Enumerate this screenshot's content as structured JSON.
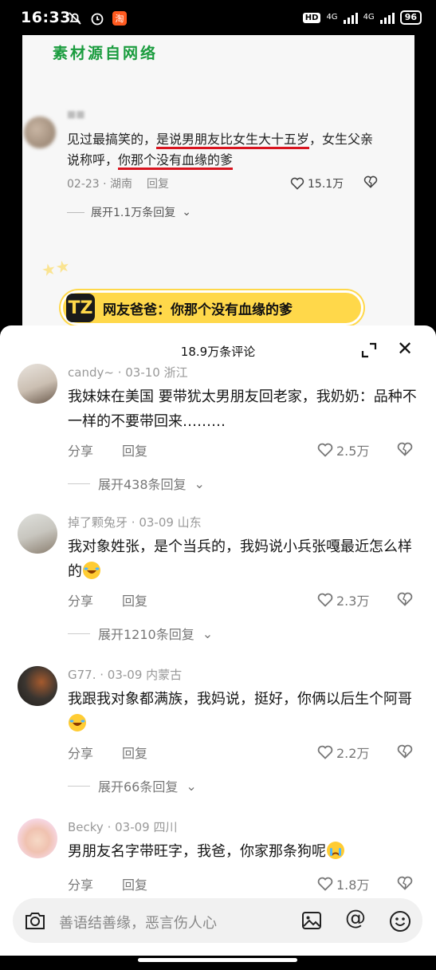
{
  "status_bar": {
    "time": "16:33",
    "hd": "HD",
    "net1": "4G",
    "net2": "4G",
    "battery": "96"
  },
  "video": {
    "watermark": "素材源自网络",
    "bg_comment": {
      "text_before": "见过最搞笑的，",
      "text_ul1": "是说男朋友比女生大十五岁",
      "text_mid": "，女生父亲说称呼，",
      "text_ul2": "你那个没有血缘的爹",
      "date_loc": "02-23 · 湖南",
      "reply": "回复",
      "likes": "15.1万",
      "expand": "展开1.1万条回复"
    },
    "banner": {
      "logo": "TZ",
      "text": "网友爸爸：你那个没有血缘的爹"
    }
  },
  "sheet": {
    "title": "18.9万条评论",
    "comments": [
      {
        "user": "candy~",
        "meta": " · 03-10 浙江",
        "text": "我妹妹在美国 要带犹太男朋友回老家，我奶奶：品种不一样的不要带回来………",
        "share": "分享",
        "reply": "回复",
        "likes": "2.5万",
        "expand": "展开438条回复"
      },
      {
        "user": "掉了颗兔牙",
        "meta": " · 03-09 山东",
        "text": "我对象姓张，是个当兵的，我妈说小兵张嘎最近怎么样的",
        "share": "分享",
        "reply": "回复",
        "likes": "2.3万",
        "expand": "展开1210条回复"
      },
      {
        "user": "G77.",
        "meta": " · 03-09 内蒙古",
        "text": "我跟我对象都满族，我妈说，挺好，你俩以后生个阿哥",
        "share": "分享",
        "reply": "回复",
        "likes": "2.2万",
        "expand": "展开66条回复"
      },
      {
        "user": "Becky",
        "meta": " · 03-09 四川",
        "text": "男朋友名字带旺字，我爸，你家那条狗呢",
        "share": "分享",
        "reply": "回复",
        "likes": "1.8万"
      }
    ]
  },
  "input": {
    "placeholder": "善语结善缘，恶言伤人心",
    "at": "@"
  },
  "colors": {
    "underline": "#d8141f",
    "watermark": "#1a9c3e",
    "banner": "#ffd84a"
  }
}
